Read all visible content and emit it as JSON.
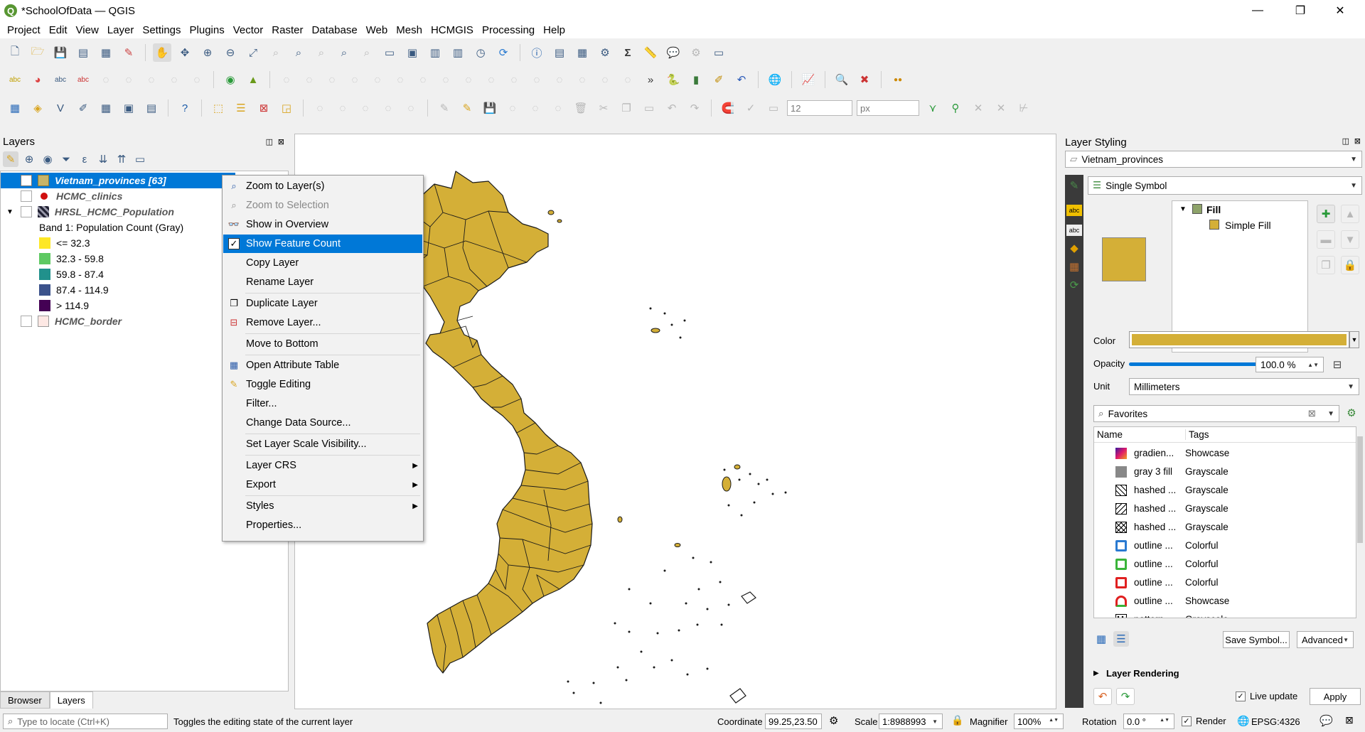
{
  "window": {
    "title": "*SchoolOfData — QGIS",
    "logo_letter": "Q",
    "minimize": "—",
    "maximize": "❐",
    "close": "✕"
  },
  "menu": [
    "Project",
    "Edit",
    "View",
    "Layer",
    "Settings",
    "Plugins",
    "Vector",
    "Raster",
    "Database",
    "Web",
    "Mesh",
    "HCMGIS",
    "Processing",
    "Help"
  ],
  "toolbar": {
    "snap_tolerance": "12",
    "snap_unit": "px"
  },
  "layers_panel": {
    "title": "Layers",
    "layers": [
      {
        "name": "Vietnam_provinces [63]",
        "checked": true,
        "selected": true
      },
      {
        "name": "HCMC_clinics",
        "checked": false
      },
      {
        "name": "HRSL_HCMC_Population",
        "checked": false
      },
      {
        "name": "HCMC_border",
        "checked": false
      }
    ],
    "band_label": "Band 1: Population Count (Gray)",
    "legend": [
      {
        "label": "<= 32.3",
        "color": "#fde725"
      },
      {
        "label": "32.3 - 59.8",
        "color": "#5ec962"
      },
      {
        "label": "59.8 - 87.4",
        "color": "#21918c"
      },
      {
        "label": "87.4 - 114.9",
        "color": "#3b528b"
      },
      {
        "label": "> 114.9",
        "color": "#440154"
      }
    ],
    "tabs": [
      "Browser",
      "Layers"
    ]
  },
  "context_menu": {
    "items": [
      {
        "label": "Zoom to Layer(s)",
        "icon": "zoom-layer-icon"
      },
      {
        "label": "Zoom to Selection",
        "icon": "zoom-selection-icon",
        "disabled": true
      },
      {
        "label": "Show in Overview",
        "icon": "overview-icon"
      },
      {
        "label": "Show Feature Count",
        "icon": "check-icon",
        "highlighted": true
      },
      {
        "label": "Copy Layer"
      },
      {
        "label": "Rename Layer"
      },
      {
        "label": "Duplicate Layer",
        "icon": "duplicate-icon"
      },
      {
        "label": "Remove Layer...",
        "icon": "remove-icon"
      },
      {
        "label": "Move to Bottom"
      },
      {
        "label": "Open Attribute Table",
        "icon": "table-icon"
      },
      {
        "label": "Toggle Editing",
        "icon": "pencil-icon"
      },
      {
        "label": "Filter..."
      },
      {
        "label": "Change Data Source..."
      },
      {
        "label": "Set Layer Scale Visibility..."
      },
      {
        "label": "Layer CRS",
        "submenu": true
      },
      {
        "label": "Export",
        "submenu": true
      },
      {
        "label": "Styles",
        "submenu": true
      },
      {
        "label": "Properties..."
      }
    ]
  },
  "style_panel": {
    "title": "Layer Styling",
    "layer": "Vietnam_provinces",
    "renderer": "Single Symbol",
    "tree": {
      "root": "Fill",
      "child": "Simple Fill"
    },
    "fill_color": "#d4af37",
    "color_label": "Color",
    "opacity_label": "Opacity",
    "opacity_value": "100.0 %",
    "opacity_fraction": 1.0,
    "unit_label": "Unit",
    "unit_value": "Millimeters",
    "search_value": "Favorites",
    "columns": [
      "Name",
      "Tags"
    ],
    "symbols": [
      {
        "name": "gradien...",
        "tag": "Showcase",
        "sw": "grad"
      },
      {
        "name": "gray 3 fill",
        "tag": "Grayscale",
        "sw": "gray"
      },
      {
        "name": "hashed ...",
        "tag": "Grayscale",
        "sw": "hash1"
      },
      {
        "name": "hashed ...",
        "tag": "Grayscale",
        "sw": "hash2"
      },
      {
        "name": "hashed ...",
        "tag": "Grayscale",
        "sw": "hash3"
      },
      {
        "name": "outline ...",
        "tag": "Colorful",
        "sw": "blue"
      },
      {
        "name": "outline ...",
        "tag": "Colorful",
        "sw": "green"
      },
      {
        "name": "outline ...",
        "tag": "Colorful",
        "sw": "red"
      },
      {
        "name": "outline ...",
        "tag": "Showcase",
        "sw": "multi"
      },
      {
        "name": "pattern ...",
        "tag": "Grayscale",
        "sw": "dot"
      }
    ],
    "save_symbol": "Save Symbol...",
    "advanced": "Advanced",
    "layer_rendering": "Layer Rendering",
    "live_update": "Live update",
    "apply": "Apply"
  },
  "statusbar": {
    "locate_placeholder": "Type to locate (Ctrl+K)",
    "message": "Toggles the editing state of the current layer",
    "coordinate_label": "Coordinate",
    "coordinate": "99.25,23.50",
    "scale_label": "Scale",
    "scale": "1:8988993",
    "magnifier_label": "Magnifier",
    "magnifier": "100%",
    "rotation_label": "Rotation",
    "rotation": "0.0 °",
    "render_label": "Render",
    "crs": "EPSG:4326"
  }
}
